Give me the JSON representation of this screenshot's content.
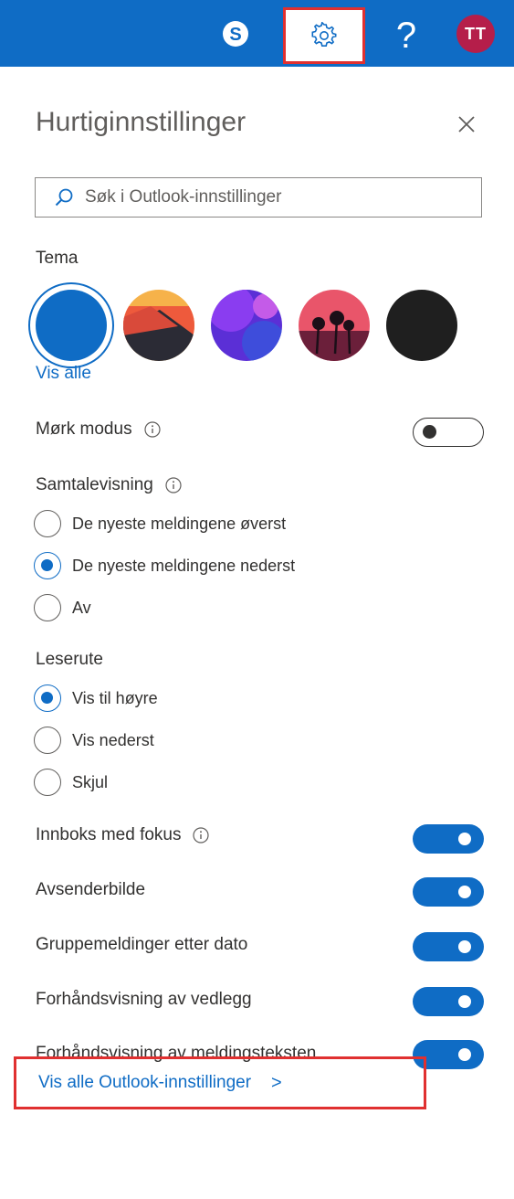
{
  "header": {
    "avatar_initials": "TT",
    "help_label": "?",
    "icons": [
      "skype-icon",
      "gear-icon",
      "help-icon"
    ],
    "brand_color": "#0f6cc5",
    "avatar_color": "#b51e4a"
  },
  "panel": {
    "title": "Hurtiginnstillinger",
    "search": {
      "placeholder": "Søk i Outlook-innstillinger",
      "value": ""
    }
  },
  "theme": {
    "label": "Tema",
    "view_all_label": "Vis alle",
    "options": [
      "blue",
      "mountain-sunset",
      "purple-abstract",
      "palm-sunset",
      "black"
    ],
    "selected": "blue"
  },
  "dark_mode": {
    "label": "Mørk modus",
    "on": false
  },
  "conversation_view": {
    "label": "Samtalevisning",
    "options": [
      {
        "label": "De nyeste meldingene øverst",
        "checked": false
      },
      {
        "label": "De nyeste meldingene nederst",
        "checked": true
      },
      {
        "label": "Av",
        "checked": false
      }
    ]
  },
  "reading_pane": {
    "label": "Leserute",
    "options": [
      {
        "label": "Vis til høyre",
        "checked": true
      },
      {
        "label": "Vis nederst",
        "checked": false
      },
      {
        "label": "Skjul",
        "checked": false
      }
    ]
  },
  "toggles": [
    {
      "label": "Innboks med fokus",
      "on": true
    },
    {
      "label": "Avsenderbilde",
      "on": true
    },
    {
      "label": "Gruppemeldinger etter dato",
      "on": true
    },
    {
      "label": "Forhåndsvisning av vedlegg",
      "on": true
    },
    {
      "label": "Forhåndsvisning av meldingsteksten",
      "on": true
    }
  ],
  "footer": {
    "all_settings_label": "Vis alle Outlook-innstillinger",
    "chevron": ">"
  }
}
